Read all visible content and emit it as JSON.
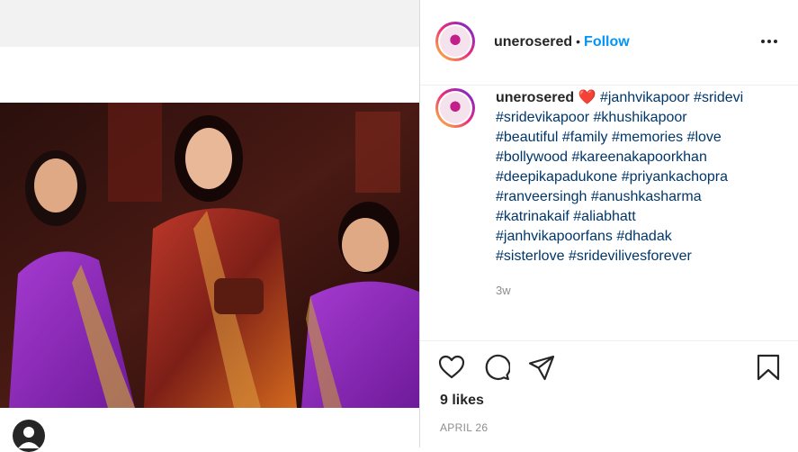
{
  "post": {
    "username": "unerosered",
    "follow_label": "Follow",
    "separator": "•",
    "caption": {
      "username": "unerosered",
      "heart": "❤️",
      "hashtags": [
        "#janhvikapoor",
        "#sridevi",
        "#sridevikapoor",
        "#khushikapoor",
        "#beautiful",
        "#family",
        "#memories",
        "#love",
        "#bollywood",
        "#kareenakapoorkhan",
        "#deepikapadukone",
        "#priyankachopra",
        "#ranveersingh",
        "#anushkasharma",
        "#katrinakaif",
        "#aliabhatt",
        "#janhvikapoorfans",
        "#dhadak",
        "#sisterlove",
        "#sridevilivesforever"
      ]
    },
    "time_ago": "3w",
    "likes": "9 likes",
    "date": "APRIL 26"
  },
  "icons": {
    "more": "more-options-icon",
    "like": "heart-icon",
    "comment": "comment-icon",
    "share": "share-icon",
    "save": "bookmark-icon"
  },
  "colors": {
    "link_blue": "#0095f6",
    "hashtag": "#00376b",
    "muted": "#8e8e8e"
  }
}
